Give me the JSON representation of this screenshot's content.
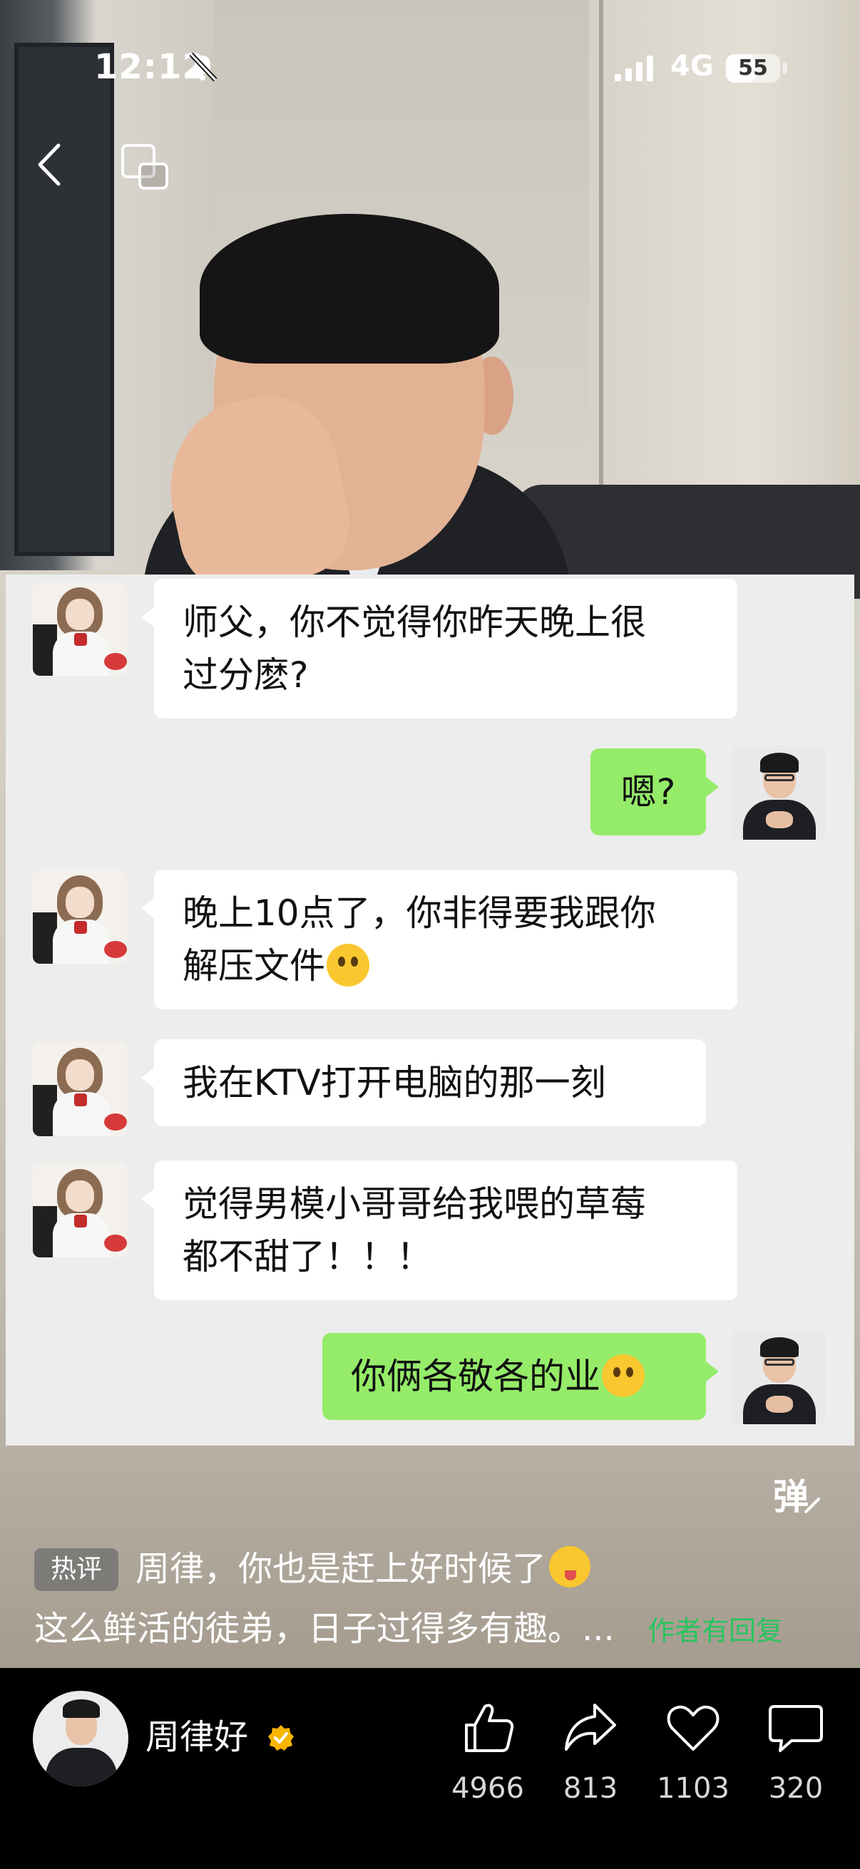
{
  "status_bar": {
    "time": "12:12",
    "network": "4G",
    "battery": "55",
    "battery_level": 0.55
  },
  "chat": {
    "messages": [
      {
        "side": "left",
        "text_line1": "师父，你不觉得你昨天晚上很",
        "text_line2": "过分麽?"
      },
      {
        "side": "right",
        "text": "嗯?"
      },
      {
        "side": "left",
        "text_line1": "晚上10点了，你非得要我跟你",
        "text_line2": "解压文件",
        "emoji": "flushed-emoji"
      },
      {
        "side": "left",
        "text": "我在KTV打开电脑的那一刻"
      },
      {
        "side": "left",
        "text_line1": "觉得男模小哥哥给我喂的草莓",
        "text_line2": "都不甜了！！！"
      },
      {
        "side": "right",
        "text": "你俩各敬各的业",
        "emoji": "smile-emoji"
      }
    ]
  },
  "danmaku_toggle": "弹",
  "hot_comment": {
    "badge": "热评",
    "line1": "周律，你也是赶上好时候了",
    "line2": "这么鲜活的徒弟，日子过得多有趣。...",
    "author_reply": "作者有回复"
  },
  "author": {
    "name": "周律好"
  },
  "actions": {
    "like_count": "4966",
    "share_count": "813",
    "favorite_count": "1103",
    "comment_count": "320"
  },
  "colors": {
    "chat_bg": "#ededed",
    "bubble_self": "#95ec69",
    "bubble_other": "#ffffff",
    "reply_green": "#29c45f"
  }
}
